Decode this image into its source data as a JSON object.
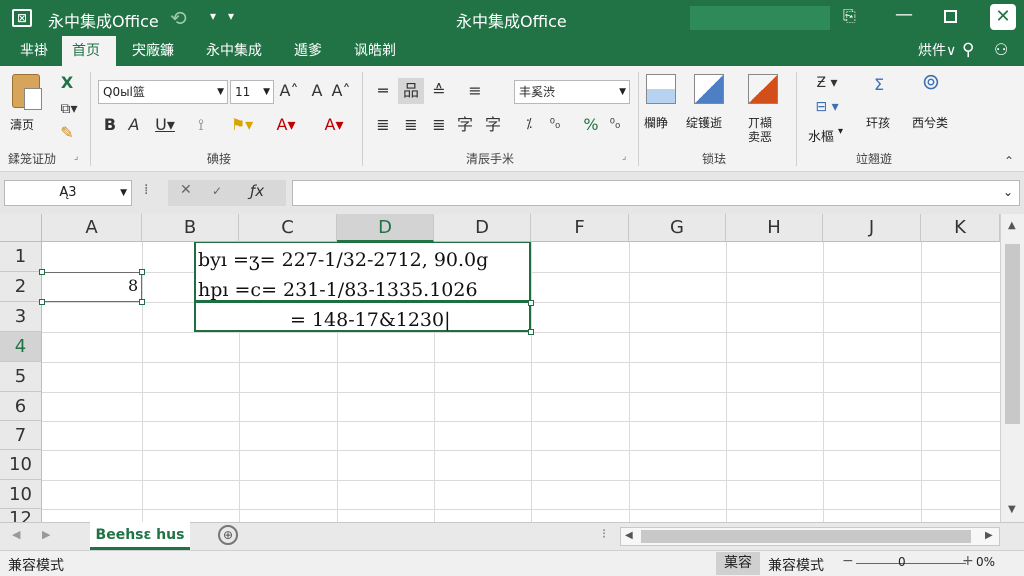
{
  "window": {
    "title_left": "永中集成Office",
    "title_center": "永中集成Office"
  },
  "tabs": [
    {
      "label": "芈褂"
    },
    {
      "label": "首页"
    },
    {
      "label": "宊廠鐮"
    },
    {
      "label": "永中集成"
    },
    {
      "label": "遁爹"
    },
    {
      "label": "讽皓剃"
    }
  ],
  "tab_right": {
    "label": "烘件∨"
  },
  "ribbon": {
    "paste_label": "濤页",
    "font_name": "Q0ыl篮",
    "font_size": "11",
    "align_combo": "丰奚渋",
    "group_clipboard": "鍒笼证劢",
    "group_font": "碘接",
    "group_align": "清辰手米",
    "group_styles": "锁珐",
    "group_cells": "竝翘遊",
    "styles_btn1": "欄睁",
    "styles_btn2": "绽镬逝",
    "styles_btn3a": "丌襭",
    "styles_btn3b": "卖恶",
    "cells_btn": "水樞",
    "edit_btn1": "玕孩",
    "edit_btn2": "西兮类"
  },
  "formula_bar": {
    "name_box": "Ą3",
    "value": ""
  },
  "grid": {
    "columns": [
      "A",
      "B",
      "C",
      "D",
      "D",
      "F",
      "G",
      "H",
      "J",
      "K"
    ],
    "rows": [
      "1",
      "2",
      "3",
      "4",
      "5",
      "6",
      "7",
      "10",
      "10",
      "12"
    ],
    "cell_b2": "8",
    "line1": "byı =ʒ= 227-1/32-2712, 90.0g",
    "line2": "hpı =c= 231-1/83-1335.1026",
    "line3": "= 148-17&1230|"
  },
  "sheet_tab": {
    "label": "Beehsɛ hus"
  },
  "status": {
    "left": "兼容模式",
    "mode_box": "菓容",
    "mode_label": "兼容模式",
    "zoom": "0",
    "zoom_pct": "0%"
  }
}
